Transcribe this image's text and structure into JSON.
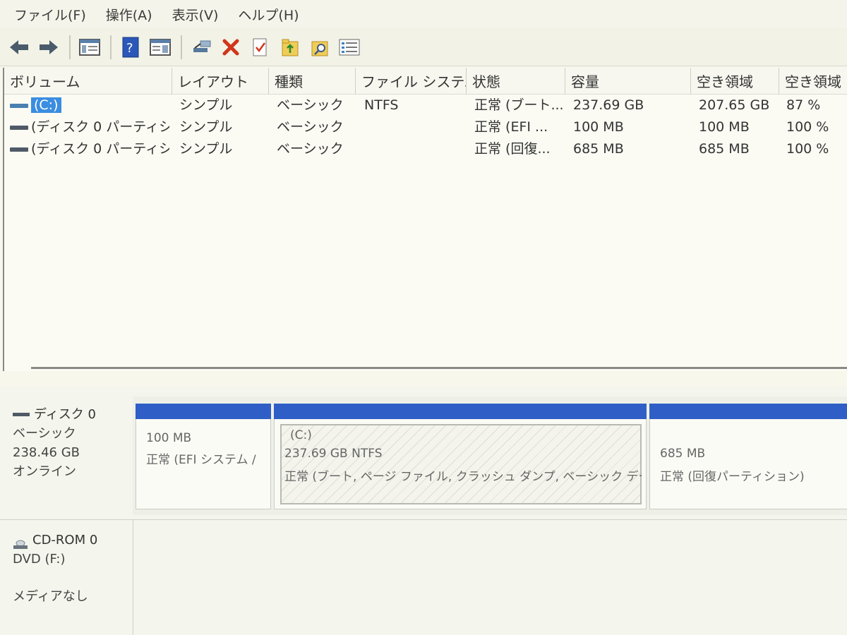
{
  "menu": [
    "ファイル(F)",
    "操作(A)",
    "表示(V)",
    "ヘルプ(H)"
  ],
  "columns": [
    "ボリューム",
    "レイアウト",
    "種類",
    "ファイル システム",
    "状態",
    "容量",
    "空き領域",
    "空き領域"
  ],
  "volumes": [
    {
      "name": "(C:)",
      "layout": "シンプル",
      "type": "ベーシック",
      "fs": "NTFS",
      "status": "正常 (ブート...",
      "capacity": "237.69 GB",
      "free": "207.65 GB",
      "free_pct": "87 %"
    },
    {
      "name": "(ディスク 0 パーティシ...",
      "layout": "シンプル",
      "type": "ベーシック",
      "fs": "",
      "status": "正常 (EFI ...",
      "capacity": "100 MB",
      "free": "100 MB",
      "free_pct": "100 %"
    },
    {
      "name": "(ディスク 0 パーティシ...",
      "layout": "シンプル",
      "type": "ベーシック",
      "fs": "",
      "status": "正常 (回復...",
      "capacity": "685 MB",
      "free": "685 MB",
      "free_pct": "100 %"
    }
  ],
  "disk0": {
    "title": "ディスク 0",
    "type": "ベーシック",
    "size": "238.46 GB",
    "state": "オンライン",
    "partitions": [
      {
        "line1": "100 MB",
        "line2": "正常 (EFI システム /"
      },
      {
        "label": "(C:)",
        "line1": "237.69 GB NTFS",
        "line2": "正常 (ブート, ページ ファイル, クラッシュ ダンプ, ベーシック デー"
      },
      {
        "line1": "685 MB",
        "line2": "正常 (回復パーティション)"
      }
    ]
  },
  "cdrom0": {
    "title": "CD-ROM 0",
    "drive": "DVD (F:)",
    "media": "メディアなし"
  },
  "colors": {
    "partition_bar": "#2f5fc6",
    "selection": "#3a8de0"
  }
}
